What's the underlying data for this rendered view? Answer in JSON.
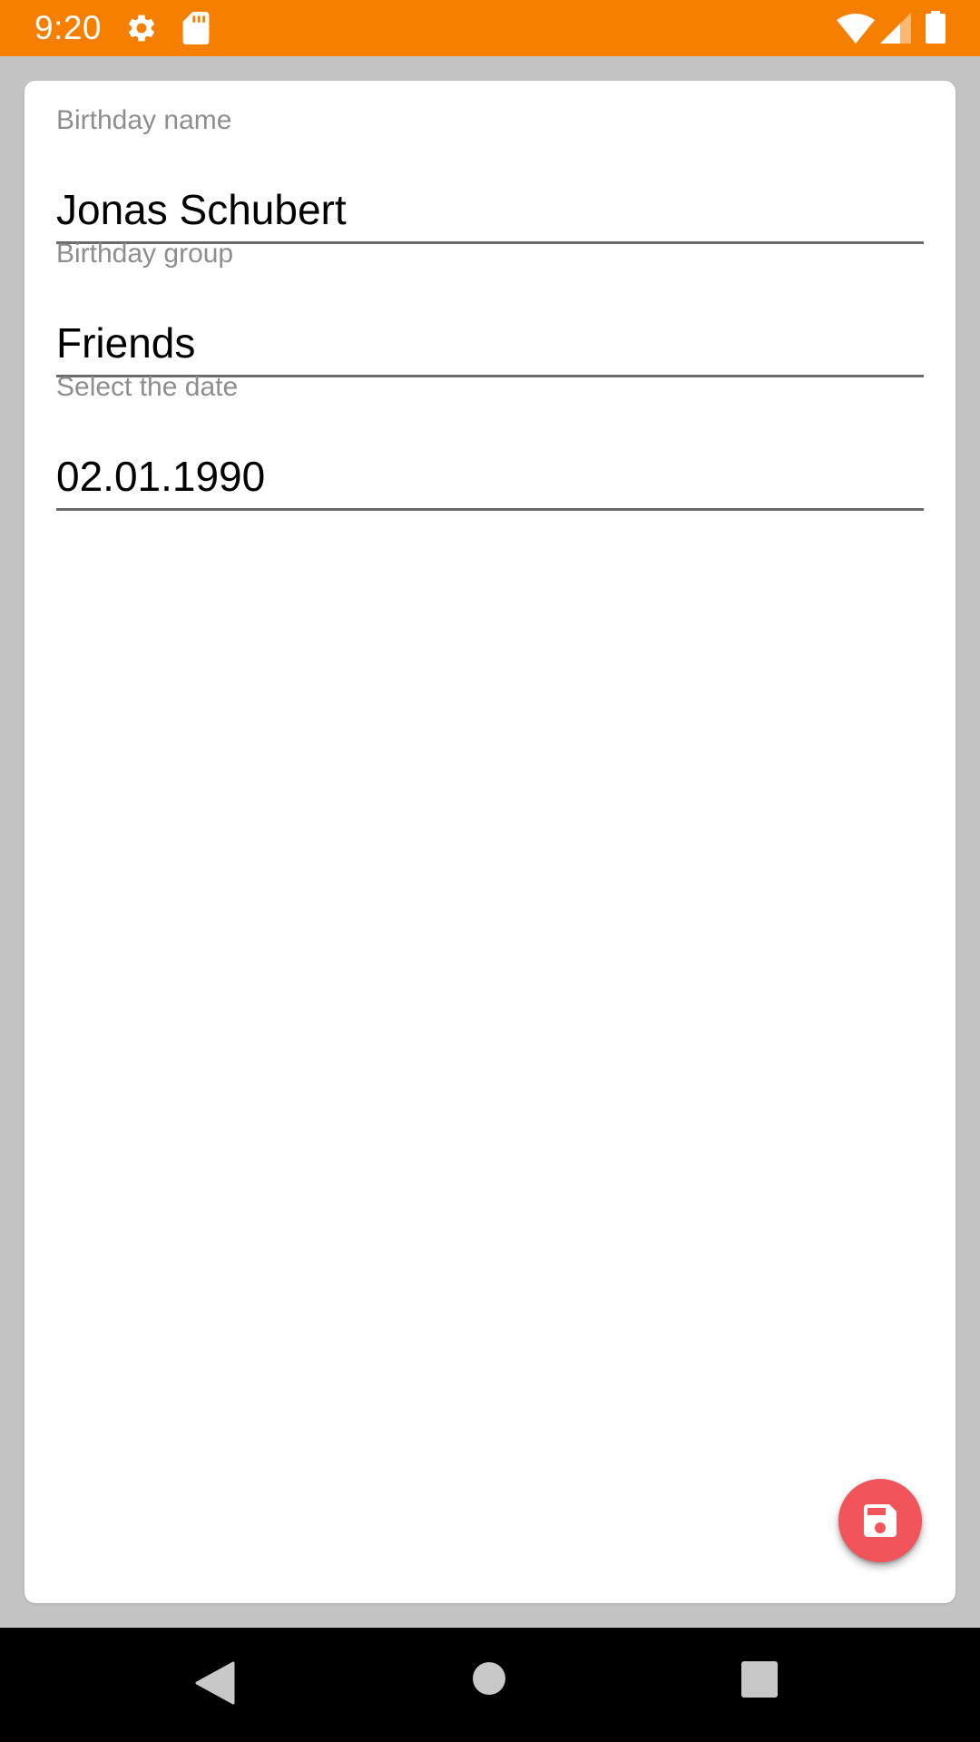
{
  "status_bar": {
    "time": "9:20",
    "icons": [
      "gear-icon",
      "sd-card-icon",
      "wifi-icon",
      "signal-icon",
      "battery-icon"
    ],
    "background_color": "#f77f00"
  },
  "form": {
    "fields": [
      {
        "label": "Birthday name",
        "value": "Jonas Schubert"
      },
      {
        "label": "Birthday group",
        "value": "Friends"
      },
      {
        "label": "Select the date",
        "value": "02.01.1990"
      }
    ]
  },
  "fab": {
    "icon": "save-icon",
    "color": "#f2545b"
  },
  "nav_bar": {
    "icons": [
      "back-icon",
      "home-icon",
      "recents-icon"
    ]
  }
}
